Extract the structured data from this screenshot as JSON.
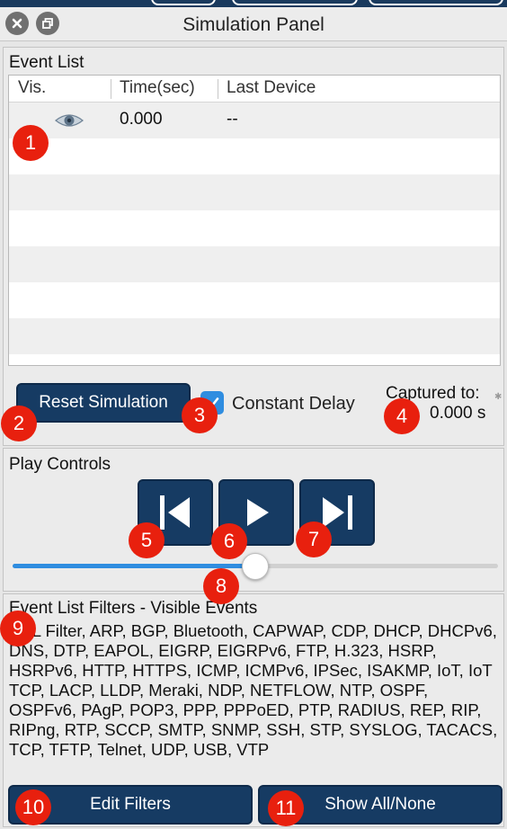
{
  "window": {
    "title": "Simulation Panel"
  },
  "event_list": {
    "label": "Event List",
    "columns": [
      "Vis.",
      "Time(sec)",
      "Last Device"
    ],
    "rows": [
      {
        "visibility_icon": "eye-icon",
        "time": "0.000",
        "last_device": "--"
      }
    ]
  },
  "controls": {
    "reset_label": "Reset Simulation",
    "constant_delay_label": "Constant Delay",
    "constant_delay_checked": true,
    "captured_label": "Captured to:",
    "captured_value": "0.000 s"
  },
  "play_controls": {
    "label": "Play Controls",
    "buttons": [
      "back-icon",
      "play-icon",
      "forward-icon"
    ],
    "speed_fraction": 0.5
  },
  "filters": {
    "label": "Event List Filters - Visible Events",
    "text": "ACL Filter, ARP, BGP, Bluetooth, CAPWAP, CDP, DHCP, DHCPv6, DNS, DTP, EAPOL, EIGRP, EIGRPv6, FTP, H.323, HSRP, HSRPv6, HTTP, HTTPS, ICMP, ICMPv6, IPSec, ISAKMP, IoT, IoT TCP, LACP, LLDP, Meraki, NDP, NETFLOW, NTP, OSPF, OSPFv6, PAgP, POP3, PPP, PPPoED, PTP, RADIUS, REP, RIP, RIPng, RTP, SCCP, SMTP, SNMP, SSH, STP, SYSLOG, TACACS, TCP, TFTP, Telnet, UDP, USB, VTP",
    "edit_label": "Edit Filters",
    "show_all_label": "Show All/None"
  },
  "annotations": [
    "1",
    "2",
    "3",
    "4",
    "5",
    "6",
    "7",
    "8",
    "9",
    "10",
    "11"
  ],
  "colors": {
    "accent_navy": "#163b63",
    "annotation_red": "#e8200e",
    "slider_blue": "#2f8de0"
  }
}
